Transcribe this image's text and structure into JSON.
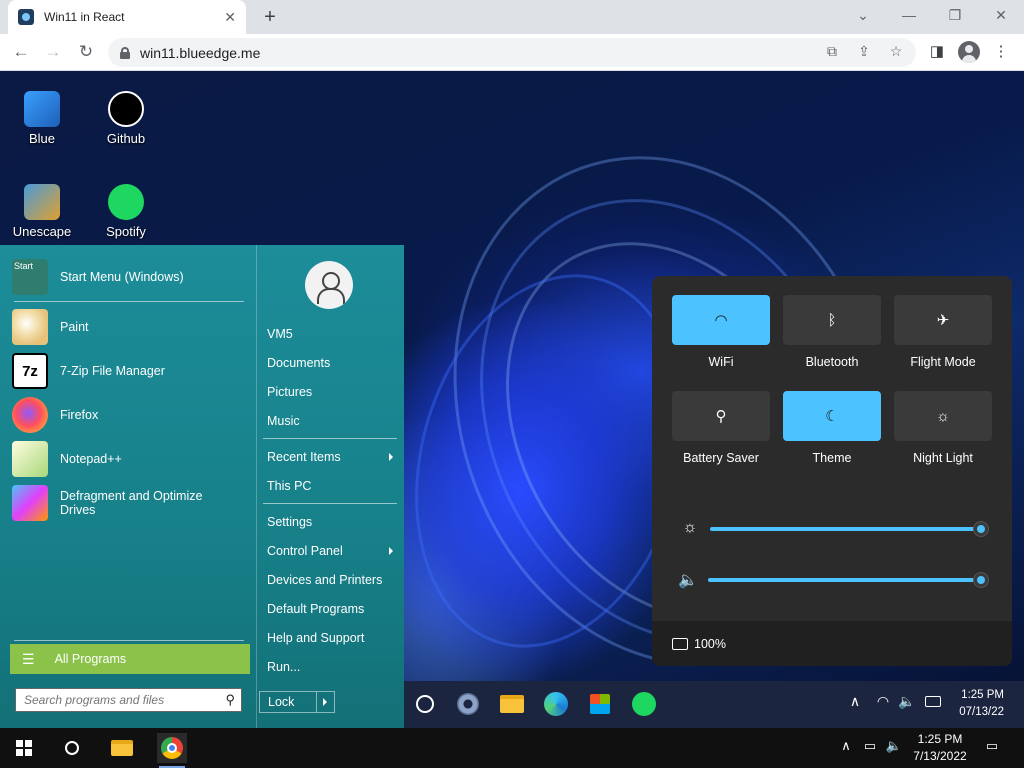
{
  "browser": {
    "tab_title": "Win11 in React",
    "tab_close": "✕",
    "new_tab": "+",
    "minimize": "⌄",
    "restore": "—",
    "maximize": "❐",
    "close": "✕",
    "back": "←",
    "forward": "→",
    "reload": "↻",
    "url": "win11.blueedge.me",
    "menu": "⋮"
  },
  "desktop": {
    "icons": [
      {
        "label": "Blue",
        "icon": "monitor-user-icon"
      },
      {
        "label": "Github",
        "icon": "github-icon"
      },
      {
        "label": "Unescape",
        "icon": "unescape-icon"
      },
      {
        "label": "Spotify",
        "icon": "spotify-icon"
      }
    ]
  },
  "start_menu": {
    "items": [
      {
        "label": "Start Menu (Windows)",
        "icon": "start-menu-icon",
        "icon_text": "Start"
      },
      {
        "label": "Paint",
        "icon": "paint-icon"
      },
      {
        "label": "7-Zip File Manager",
        "icon": "7zip-icon",
        "icon_text": "7z"
      },
      {
        "label": "Firefox",
        "icon": "firefox-icon"
      },
      {
        "label": "Notepad++",
        "icon": "notepadpp-icon"
      },
      {
        "label": "Defragment and Optimize Drives",
        "icon": "defrag-icon"
      }
    ],
    "all_programs": "All Programs",
    "search_placeholder": "Search programs and files",
    "right_links": [
      "VM5",
      "Documents",
      "Pictures",
      "Music",
      "Recent Items",
      "This PC",
      "Settings",
      "Control Panel",
      "Devices and Printers",
      "Default Programs",
      "Help and Support",
      "Run..."
    ],
    "lock": "Lock"
  },
  "quick_settings": {
    "tiles": [
      {
        "label": "WiFi",
        "icon": "wifi-icon",
        "glyph": "◠",
        "on": true
      },
      {
        "label": "Bluetooth",
        "icon": "bluetooth-icon",
        "glyph": "ᛒ",
        "on": false
      },
      {
        "label": "Flight Mode",
        "icon": "airplane-icon",
        "glyph": "✈",
        "on": false
      },
      {
        "label": "Battery Saver",
        "icon": "battery-saver-icon",
        "glyph": "⚲",
        "on": false
      },
      {
        "label": "Theme",
        "icon": "moon-icon",
        "glyph": "☾",
        "on": true
      },
      {
        "label": "Night Light",
        "icon": "night-light-icon",
        "glyph": "☼",
        "on": false
      }
    ],
    "brightness_glyph": "☼",
    "volume_glyph": "🔈",
    "brightness_level": 1.0,
    "volume_level": 1.0,
    "battery": "100%"
  },
  "inner_taskbar": {
    "time": "1:25 PM",
    "date": "07/13/22",
    "tray_chevron": "∧",
    "tray_wifi": "◠",
    "tray_volume": "🔈"
  },
  "host_taskbar": {
    "time": "1:25 PM",
    "date": "7/13/2022",
    "tray_chevron": "∧",
    "tray_network": "▭",
    "tray_volume": "🔈",
    "notification": "▭"
  }
}
